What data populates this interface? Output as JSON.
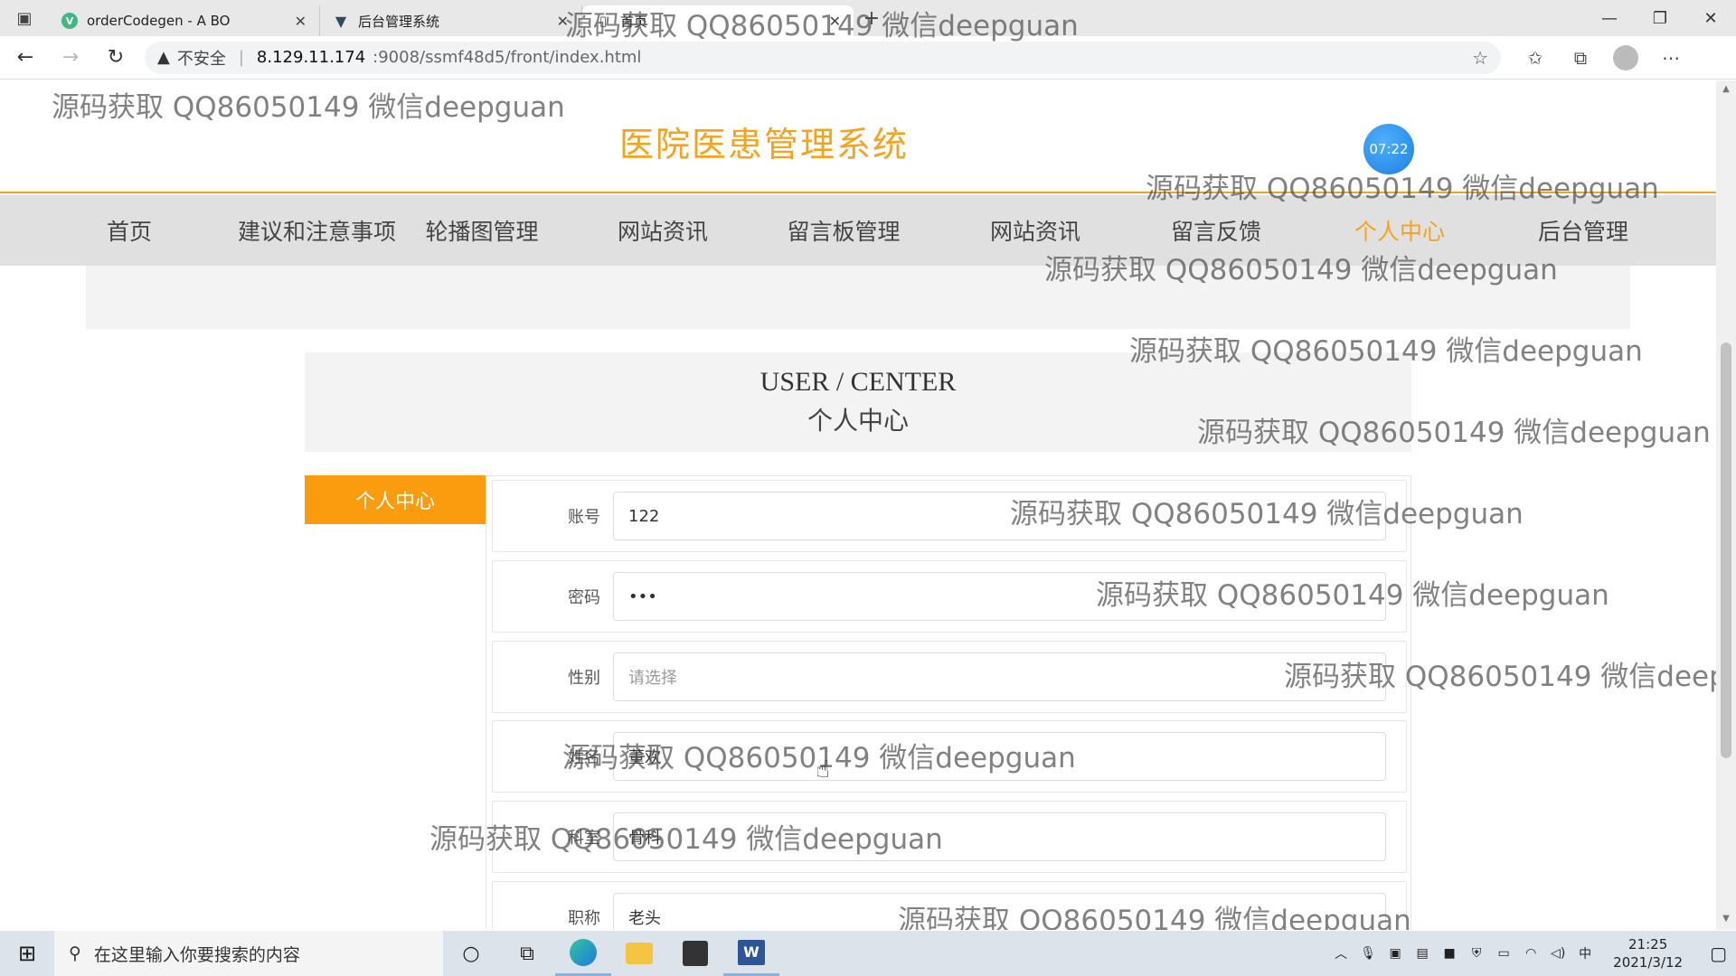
{
  "browser": {
    "tabs": [
      {
        "title": "orderCodegen - A BO",
        "icon": "vue-icon"
      },
      {
        "title": "后台管理系统",
        "icon": "vue-icon"
      },
      {
        "title": "首页",
        "icon": "page-icon"
      }
    ],
    "url_warning": "不安全",
    "url_host": "8.129.11.174",
    "url_path": ":9008/ssmf48d5/front/index.html"
  },
  "site": {
    "title": "医院医患管理系统",
    "clock": "07:22",
    "nav": [
      "首页",
      "建议和注意事项",
      "轮播图管理",
      "网站资讯",
      "留言板管理",
      "网站资讯",
      "留言反馈",
      "个人中心",
      "后台管理"
    ],
    "active_nav_index": 7
  },
  "section": {
    "title_en": "USER / CENTER",
    "title_cn": "个人中心"
  },
  "side_menu": {
    "item": "个人中心"
  },
  "form": {
    "rows": [
      {
        "label": "账号",
        "value": "122"
      },
      {
        "label": "密码",
        "value": "•••"
      },
      {
        "label": "性别",
        "placeholder": "请选择"
      },
      {
        "label": "姓名",
        "value": "董欢"
      },
      {
        "label": "科室",
        "value": "骨科"
      },
      {
        "label": "职称",
        "value": "老头"
      }
    ]
  },
  "watermark": "源码获取 QQ86050149 微信deepguan",
  "taskbar": {
    "search_placeholder": "在这里输入你要搜索的内容",
    "ime": "中",
    "time": "21:25",
    "date": "2021/3/12"
  },
  "colors": {
    "accent": "#f7a21b",
    "side_menu_bg": "#fb9b0e",
    "nav_bg": "#e0e0e0"
  }
}
